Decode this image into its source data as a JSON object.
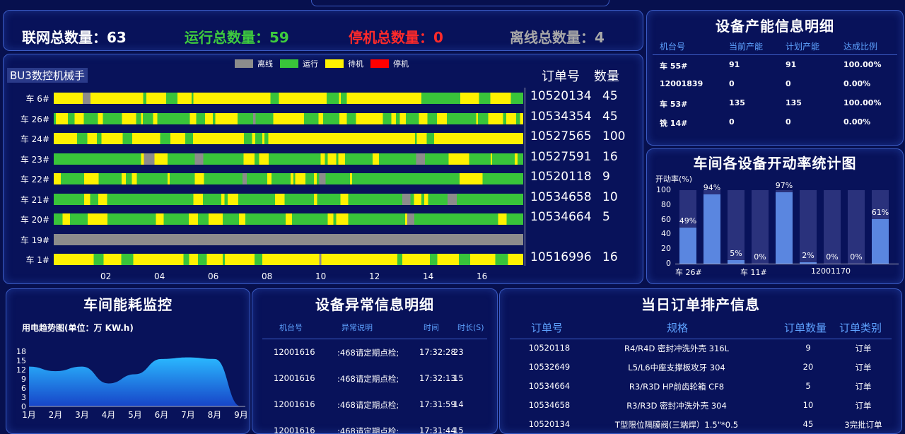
{
  "stats": {
    "online_label": "联网总数量：",
    "online_value": "63",
    "running_label": "运行总数量：",
    "running_value": "59",
    "stopped_label": "停机总数量：",
    "stopped_value": "0",
    "offline_label": "离线总数量：",
    "offline_value": "4"
  },
  "timeline": {
    "title": "BU3数控机械手",
    "order_header": "订单号",
    "qty_header": "数量",
    "legend": [
      {
        "label": "离线",
        "color": "#8c8c8c"
      },
      {
        "label": "运行",
        "color": "#39c43a"
      },
      {
        "label": "待机",
        "color": "#fff200"
      },
      {
        "label": "停机",
        "color": "#ff0000"
      }
    ],
    "rows": [
      {
        "machine": "车 6#",
        "order": "10520134",
        "qty": "45",
        "pattern": "yellow"
      },
      {
        "machine": "车 26#",
        "order": "10534354",
        "qty": "45",
        "pattern": "mixed"
      },
      {
        "machine": "车 24#",
        "order": "10527565",
        "qty": "100",
        "pattern": "yellow"
      },
      {
        "machine": "车 23#",
        "order": "10527591",
        "qty": "16",
        "pattern": "green"
      },
      {
        "machine": "车 22#",
        "order": "10520118",
        "qty": "9",
        "pattern": "green"
      },
      {
        "machine": "车 21#",
        "order": "10534658",
        "qty": "10",
        "pattern": "green"
      },
      {
        "machine": "车 20#",
        "order": "10534664",
        "qty": "5",
        "pattern": "green"
      },
      {
        "machine": "车 19#",
        "order": "",
        "qty": "",
        "pattern": "gray"
      },
      {
        "machine": "车 1#",
        "order": "10516996",
        "qty": "16",
        "pattern": "yellow"
      }
    ],
    "x_ticks": [
      "02",
      "04",
      "06",
      "08",
      "10",
      "12",
      "14",
      "16"
    ]
  },
  "capacity": {
    "title": "设备产能信息明细",
    "headers": [
      "机台号",
      "当前产能",
      "计划产能",
      "达成比例"
    ],
    "rows": [
      [
        "车 55#",
        "91",
        "91",
        "100.00%"
      ],
      [
        "12001839",
        "0",
        "0",
        "0.00%"
      ],
      [
        "车 53#",
        "135",
        "135",
        "100.00%"
      ],
      [
        "铣 14#",
        "0",
        "0",
        "0.00%"
      ]
    ]
  },
  "rate_chart": {
    "title": "车间各设备开动率统计图",
    "ylabel": "开动率(%)",
    "y_ticks": [
      "100",
      "80",
      "60",
      "40",
      "20",
      "0"
    ],
    "x_labels": [
      "车 26#",
      "车 11#",
      "12001170"
    ]
  },
  "chart_data": [
    {
      "type": "bar",
      "title": "车间各设备开动率统计图",
      "ylabel": "开动率(%)",
      "ylim": [
        0,
        100
      ],
      "categories": [
        "车 26#",
        "",
        "",
        "车 11#",
        "",
        "12001170",
        "",
        "",
        ""
      ],
      "values": [
        49,
        94,
        5,
        0,
        97,
        2,
        0,
        0,
        61
      ],
      "value_labels": [
        "49%",
        "94%",
        "5%",
        "0%",
        "97%",
        "2%",
        "0%",
        "0%",
        "61%"
      ]
    },
    {
      "type": "area",
      "title": "用电趋势图(单位：万 KW.h)",
      "x": [
        "1月",
        "2月",
        "3月",
        "4月",
        "5月",
        "6月",
        "7月",
        "8月",
        "9月"
      ],
      "values": [
        13,
        11.5,
        13,
        7.5,
        10.5,
        15.5,
        16,
        15.5,
        0
      ],
      "ylim": [
        0,
        18
      ],
      "y_ticks": [
        "18",
        "15",
        "12",
        "9",
        "6",
        "3",
        "0"
      ]
    }
  ],
  "energy": {
    "title": "车间能耗监控",
    "subtitle": "用电趋势图(单位：万 KW.h)"
  },
  "abnormal": {
    "title": "设备异常信息明细",
    "headers": [
      "机台号",
      "异常说明",
      "时间",
      "时长(S)"
    ],
    "rows": [
      [
        "12001616",
        ":468请定期点检;",
        "17:32:28",
        "23"
      ],
      [
        "12001616",
        ":468请定期点检;",
        "17:32:13",
        "15"
      ],
      [
        "12001616",
        ":468请定期点检;",
        "17:31:59",
        "14"
      ],
      [
        "12001616",
        ":468请定期点检;",
        "17:31:44",
        "15"
      ]
    ]
  },
  "orders": {
    "title": "当日订单排产信息",
    "headers": [
      "订单号",
      "规格",
      "订单数量",
      "订单类别"
    ],
    "rows": [
      [
        "10520118",
        "R4/R4D 密封冲洗外壳 316L",
        "9",
        "订单"
      ],
      [
        "10532649",
        "L5/L6中座支撑板攻牙 304",
        "20",
        "订单"
      ],
      [
        "10534664",
        "R3/R3D HP前齿轮箱 CF8",
        "5",
        "订单"
      ],
      [
        "10534658",
        "R3/R3D 密封冲洗外壳 304",
        "10",
        "订单"
      ],
      [
        "10520134",
        "T型限位隔膜阀(三端焊）1.5\"*0.5",
        "45",
        "3完批订单"
      ]
    ]
  }
}
